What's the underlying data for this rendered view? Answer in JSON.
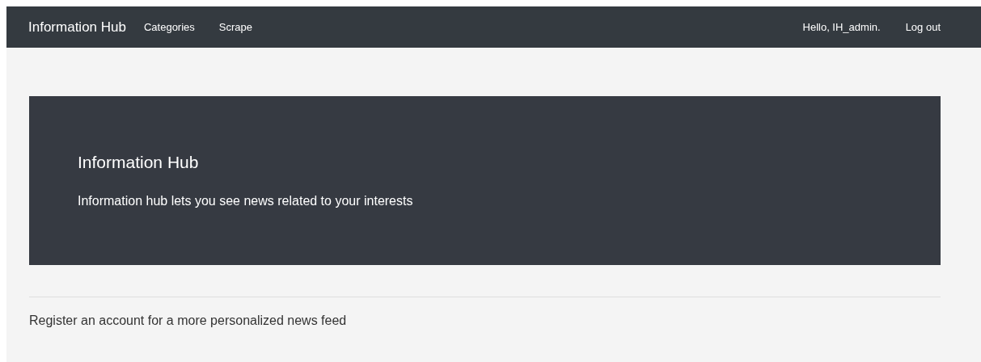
{
  "navbar": {
    "brand": "Information Hub",
    "links": [
      "Categories",
      "Scrape"
    ],
    "greeting": "Hello, IH_admin.",
    "logout": "Log out"
  },
  "jumbotron": {
    "title": "Information Hub",
    "lead": "Information hub lets you see news related to your interests"
  },
  "message": "Register an account for a more personalized news feed"
}
